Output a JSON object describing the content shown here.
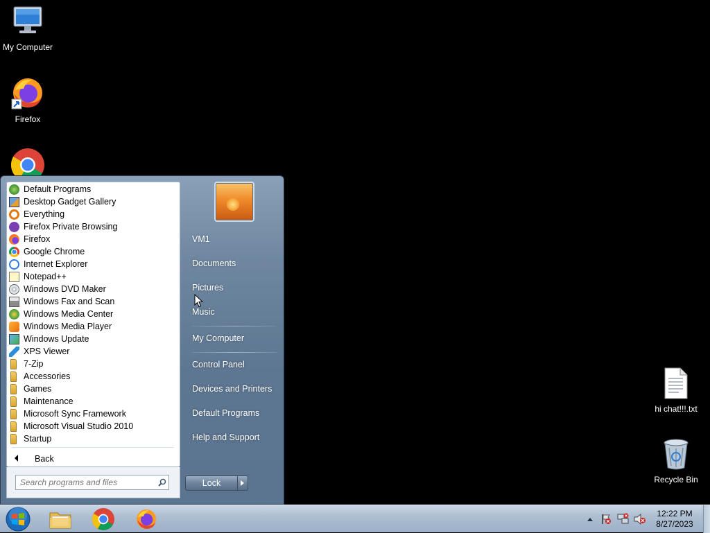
{
  "desktop": {
    "icons_left": [
      {
        "label": "My Computer",
        "icon": "computer-icon"
      },
      {
        "label": "Firefox",
        "icon": "firefox-icon"
      },
      {
        "label": "",
        "icon": "chrome-icon"
      }
    ],
    "icons_right": [
      {
        "label": "hi chat!!!.txt",
        "icon": "text-file-icon"
      },
      {
        "label": "Recycle Bin",
        "icon": "recycle-bin-icon"
      }
    ]
  },
  "start_menu": {
    "programs": [
      {
        "label": "Default Programs",
        "icon": "default-programs-icon"
      },
      {
        "label": "Desktop Gadget Gallery",
        "icon": "gadget-icon"
      },
      {
        "label": "Everything",
        "icon": "search-icon"
      },
      {
        "label": "Firefox Private Browsing",
        "icon": "private-browsing-icon"
      },
      {
        "label": "Firefox",
        "icon": "firefox-icon"
      },
      {
        "label": "Google Chrome",
        "icon": "chrome-icon"
      },
      {
        "label": "Internet Explorer",
        "icon": "ie-icon"
      },
      {
        "label": "Notepad++",
        "icon": "notepad-icon"
      },
      {
        "label": "Windows DVD Maker",
        "icon": "dvd-icon"
      },
      {
        "label": "Windows Fax and Scan",
        "icon": "fax-icon"
      },
      {
        "label": "Windows Media Center",
        "icon": "media-center-icon"
      },
      {
        "label": "Windows Media Player",
        "icon": "media-player-icon"
      },
      {
        "label": "Windows Update",
        "icon": "update-icon"
      },
      {
        "label": "XPS Viewer",
        "icon": "xps-icon"
      },
      {
        "label": "7-Zip",
        "icon": "folder-icon"
      },
      {
        "label": "Accessories",
        "icon": "folder-icon"
      },
      {
        "label": "Games",
        "icon": "folder-icon"
      },
      {
        "label": "Maintenance",
        "icon": "folder-icon"
      },
      {
        "label": "Microsoft Sync Framework",
        "icon": "folder-icon"
      },
      {
        "label": "Microsoft Visual Studio 2010",
        "icon": "folder-icon"
      },
      {
        "label": "Startup",
        "icon": "folder-icon"
      }
    ],
    "back_label": "Back",
    "search_placeholder": "Search programs and files",
    "right_items": [
      {
        "label": "VM1"
      },
      {
        "label": "Documents"
      },
      {
        "label": "Pictures"
      },
      {
        "label": "Music"
      },
      {
        "label": "My Computer"
      },
      {
        "label": "Control Panel"
      },
      {
        "label": "Devices and Printers"
      },
      {
        "label": "Default Programs"
      },
      {
        "label": "Help and Support"
      }
    ],
    "lock_label": "Lock"
  },
  "taskbar": {
    "pinned": [
      {
        "name": "windows-explorer",
        "icon": "folder-icon"
      },
      {
        "name": "google-chrome",
        "icon": "chrome-icon"
      },
      {
        "name": "firefox",
        "icon": "firefox-icon"
      }
    ],
    "clock_time": "12:22 PM",
    "clock_date": "8/27/2023"
  }
}
